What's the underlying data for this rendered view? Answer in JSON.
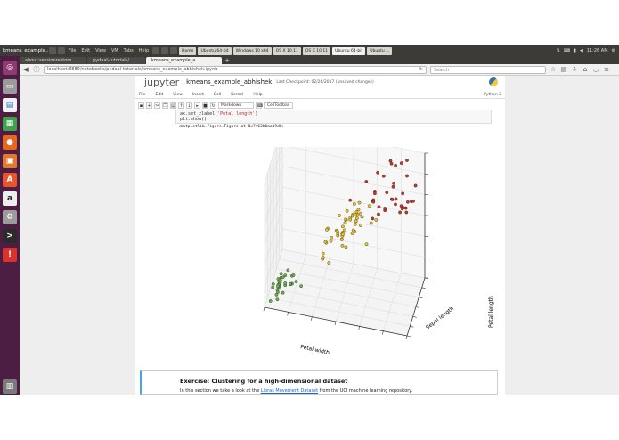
{
  "topbar": {
    "app_name": "kmeans_example...",
    "menu": [
      "File",
      "Edit",
      "View",
      "VM",
      "Tabs",
      "Help"
    ],
    "vm_tabs": [
      "Home",
      "Ubuntu 64-bit",
      "Windows 10 x64",
      "OS X 10.11",
      "OS X 10.11",
      "Ubuntu 64-bit",
      "Ubuntu ..."
    ],
    "active_vm_tab": 5,
    "clock": "11:26 AM"
  },
  "browser": {
    "tabs": [
      "about:sessionrestore",
      "pydaal-tutorials/",
      "kmeans_example_a..."
    ],
    "active_tab": 2,
    "new_tab": "+",
    "url": "localhost:8889/notebooks/pydaal-tutorials/kmeans_example_abhishek.ipynb",
    "search_placeholder": "Search"
  },
  "notebook": {
    "logo": "jupyter",
    "title": "kmeans_example_abhishek",
    "checkpoint": "Last Checkpoint: 02/26/2017 (unsaved changes)",
    "menu": [
      "File",
      "Edit",
      "View",
      "Insert",
      "Cell",
      "Kernel",
      "Help"
    ],
    "kernel": "Python 2",
    "cell_type": "Markdown",
    "cell_toolbar": "CellToolbar",
    "code_line1_prefix": "ax.set_zlabel(",
    "code_line1_string": "'Petal length'",
    "code_line1_suffix": ")",
    "code_line2": "plt.show()",
    "output": "<matplotlib.figure.Figure at 0x7f62b0aa09d0>"
  },
  "chart_data": {
    "type": "scatter",
    "xlabel": "Petal width",
    "ylabel": "Sepal length",
    "zlabel": "Petal length",
    "clusters": [
      {
        "color": "#6ab04c",
        "points": [
          [
            0.2,
            5.0,
            1.4
          ],
          [
            0.2,
            4.9,
            1.4
          ],
          [
            0.2,
            4.7,
            1.3
          ],
          [
            0.2,
            4.6,
            1.5
          ],
          [
            0.2,
            5.0,
            1.4
          ],
          [
            0.4,
            5.4,
            1.7
          ],
          [
            0.3,
            4.6,
            1.4
          ],
          [
            0.2,
            5.0,
            1.5
          ],
          [
            0.2,
            4.4,
            1.4
          ],
          [
            0.1,
            4.9,
            1.5
          ],
          [
            0.2,
            5.4,
            1.5
          ],
          [
            0.2,
            4.8,
            1.6
          ],
          [
            0.1,
            4.8,
            1.4
          ],
          [
            0.1,
            4.3,
            1.1
          ],
          [
            0.2,
            5.8,
            1.2
          ],
          [
            0.4,
            5.7,
            1.5
          ],
          [
            0.4,
            5.4,
            1.3
          ],
          [
            0.3,
            5.1,
            1.4
          ],
          [
            0.3,
            5.7,
            1.7
          ],
          [
            0.3,
            5.1,
            1.5
          ],
          [
            0.2,
            5.4,
            1.7
          ],
          [
            0.4,
            5.1,
            1.5
          ],
          [
            0.2,
            4.6,
            1.0
          ],
          [
            0.5,
            5.1,
            1.7
          ],
          [
            0.2,
            4.8,
            1.9
          ],
          [
            0.2,
            5.0,
            1.6
          ],
          [
            0.4,
            5.0,
            1.6
          ],
          [
            0.2,
            5.2,
            1.5
          ],
          [
            0.2,
            5.2,
            1.4
          ],
          [
            0.2,
            4.7,
            1.6
          ],
          [
            0.6,
            5.0,
            1.6
          ],
          [
            0.3,
            5.1,
            1.9
          ]
        ]
      },
      {
        "color": "#e6c229",
        "points": [
          [
            1.4,
            7.0,
            4.7
          ],
          [
            1.5,
            6.4,
            4.5
          ],
          [
            1.5,
            6.9,
            4.9
          ],
          [
            1.3,
            5.5,
            4.0
          ],
          [
            1.5,
            6.5,
            4.6
          ],
          [
            1.3,
            5.7,
            4.5
          ],
          [
            1.6,
            6.3,
            4.7
          ],
          [
            1.0,
            4.9,
            3.3
          ],
          [
            1.3,
            6.6,
            4.6
          ],
          [
            1.4,
            5.2,
            3.9
          ],
          [
            1.0,
            5.0,
            3.5
          ],
          [
            1.5,
            5.9,
            4.2
          ],
          [
            1.0,
            6.0,
            4.0
          ],
          [
            1.4,
            6.1,
            4.7
          ],
          [
            1.3,
            5.6,
            3.6
          ],
          [
            1.4,
            6.7,
            4.4
          ],
          [
            1.5,
            5.6,
            4.5
          ],
          [
            1.0,
            5.8,
            4.1
          ],
          [
            1.5,
            6.2,
            4.5
          ],
          [
            1.1,
            5.6,
            3.9
          ],
          [
            1.8,
            5.9,
            4.8
          ],
          [
            1.3,
            6.1,
            4.0
          ],
          [
            1.5,
            6.3,
            4.9
          ],
          [
            1.2,
            6.1,
            4.7
          ],
          [
            1.3,
            6.4,
            4.3
          ],
          [
            1.4,
            6.6,
            4.4
          ],
          [
            1.7,
            6.7,
            5.0
          ],
          [
            1.5,
            6.0,
            4.5
          ],
          [
            1.0,
            5.7,
            3.5
          ],
          [
            1.1,
            5.5,
            3.8
          ],
          [
            1.0,
            5.5,
            3.7
          ],
          [
            1.2,
            5.8,
            3.9
          ],
          [
            1.6,
            6.0,
            5.1
          ],
          [
            1.5,
            5.4,
            4.5
          ],
          [
            1.6,
            6.0,
            4.5
          ],
          [
            1.5,
            6.7,
            4.7
          ],
          [
            1.3,
            6.3,
            4.4
          ],
          [
            1.3,
            5.6,
            4.1
          ],
          [
            1.3,
            5.5,
            4.0
          ],
          [
            1.2,
            5.5,
            4.4
          ],
          [
            1.4,
            6.1,
            4.6
          ],
          [
            1.2,
            5.8,
            4.0
          ],
          [
            1.0,
            5.0,
            3.3
          ],
          [
            1.3,
            5.6,
            4.2
          ],
          [
            1.2,
            5.7,
            4.2
          ],
          [
            1.3,
            5.7,
            4.2
          ],
          [
            1.3,
            6.2,
            4.3
          ],
          [
            1.1,
            5.1,
            3.0
          ],
          [
            1.3,
            5.7,
            4.1
          ],
          [
            1.8,
            4.9,
            4.5
          ],
          [
            1.9,
            5.8,
            5.1
          ],
          [
            1.5,
            6.0,
            5.0
          ]
        ]
      },
      {
        "color": "#c0392b",
        "points": [
          [
            2.5,
            6.3,
            6.0
          ],
          [
            2.1,
            7.1,
            5.9
          ],
          [
            1.8,
            6.3,
            5.6
          ],
          [
            2.2,
            6.5,
            5.8
          ],
          [
            2.1,
            7.6,
            6.6
          ],
          [
            1.8,
            7.3,
            6.3
          ],
          [
            1.8,
            6.7,
            5.8
          ],
          [
            2.5,
            7.2,
            6.1
          ],
          [
            2.0,
            6.5,
            5.1
          ],
          [
            1.9,
            6.4,
            5.3
          ],
          [
            2.1,
            6.8,
            5.5
          ],
          [
            2.4,
            6.4,
            5.3
          ],
          [
            2.3,
            6.5,
            5.5
          ],
          [
            2.2,
            7.7,
            6.7
          ],
          [
            2.3,
            7.7,
            6.9
          ],
          [
            2.0,
            6.9,
            5.7
          ],
          [
            2.0,
            7.7,
            6.7
          ],
          [
            1.8,
            6.7,
            5.7
          ],
          [
            2.1,
            7.2,
            6.0
          ],
          [
            1.8,
            6.2,
            4.8
          ],
          [
            1.8,
            6.4,
            5.6
          ],
          [
            1.6,
            7.2,
            5.8
          ],
          [
            1.9,
            7.4,
            6.1
          ],
          [
            2.0,
            7.9,
            6.4
          ],
          [
            2.2,
            6.4,
            5.6
          ],
          [
            1.4,
            6.1,
            5.6
          ],
          [
            2.3,
            7.7,
            6.1
          ],
          [
            2.4,
            6.3,
            5.6
          ],
          [
            1.8,
            6.4,
            5.5
          ],
          [
            2.1,
            6.9,
            5.4
          ],
          [
            2.4,
            6.7,
            5.6
          ],
          [
            2.3,
            6.9,
            5.1
          ],
          [
            2.3,
            6.8,
            5.9
          ],
          [
            2.5,
            6.7,
            5.7
          ],
          [
            2.3,
            6.7,
            5.2
          ],
          [
            1.9,
            6.3,
            5.0
          ],
          [
            2.0,
            6.5,
            5.2
          ],
          [
            2.3,
            6.2,
            5.4
          ]
        ]
      }
    ]
  },
  "exercise": {
    "title": "Exercise: Clustering for a high-dimensional dataset",
    "text_before": "In this section we take a look at the ",
    "link": "Libras Movement Dataset",
    "text_after": " from the UCI machine learning repository."
  }
}
